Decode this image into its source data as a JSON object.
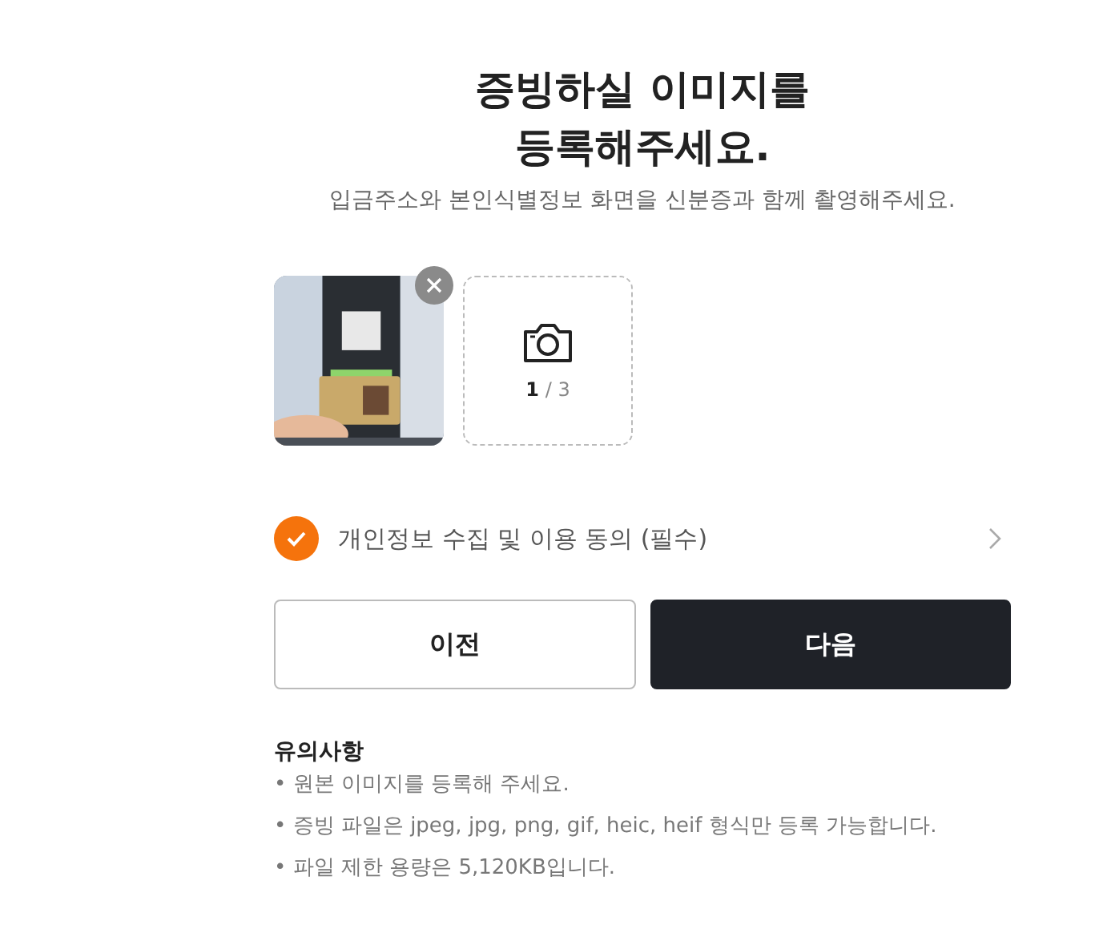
{
  "title_lines": [
    "증빙하실 이미지를",
    "등록해주세요."
  ],
  "subtitle": "입금주소와 본인식별정보 화면을 신분증과 함께 촬영해주세요.",
  "uploads": [
    {
      "kind": "picture"
    }
  ],
  "add_slot": {
    "count": "1",
    "total": "/ 3"
  },
  "consent": {
    "label": "개인정보 수집 및 이용 동의 (필수)",
    "checked": true
  },
  "buttons": [
    {
      "label": "이전",
      "kind": "secondary"
    },
    {
      "label": "다음",
      "kind": "primary"
    }
  ],
  "notes": {
    "title": "유의사항",
    "items": [
      "• 원본 이미지를 등록해 주세요.",
      "• 증빙 파일은 jpeg, jpg, png, gif, heic, heif 형식만 등록 가능합니다.",
      "• 파일 제한 용량은 5,120KB입니다."
    ]
  }
}
